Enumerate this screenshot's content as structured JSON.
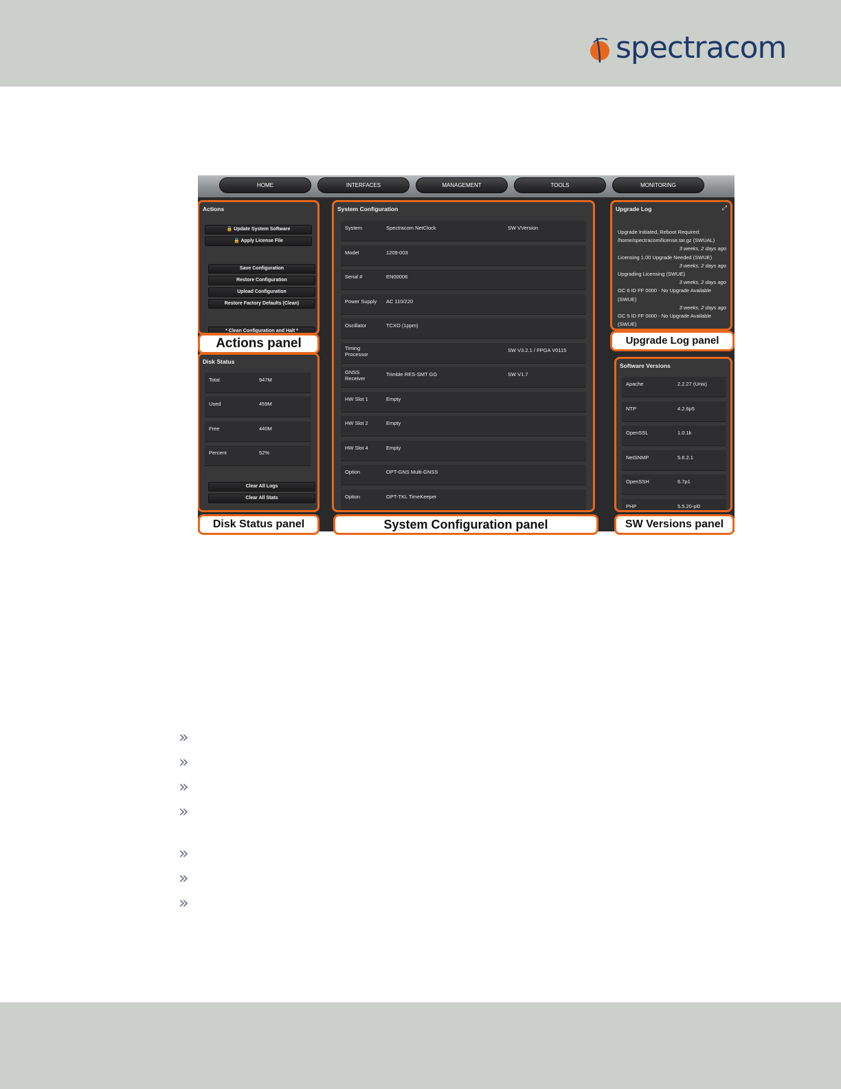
{
  "brand": {
    "logo_text": "spectracom",
    "accent_color": "#e8671c",
    "text_color": "#1e3a6b"
  },
  "nav": {
    "items": [
      "HOME",
      "INTERFACES",
      "MANAGEMENT",
      "TOOLS",
      "MONITORING"
    ]
  },
  "actions": {
    "title": "Actions",
    "buttons": [
      "🔒 Update System Software",
      "🔒 Apply License File",
      "Save Configuration",
      "Restore Configuration",
      "Upload Configuration",
      "Restore Factory Defaults (Clean)",
      "* Clean Configuration and Halt *"
    ],
    "caption": "Actions panel"
  },
  "disk": {
    "title": "Disk Status",
    "rows": [
      {
        "label": "Total",
        "value": "947M"
      },
      {
        "label": "Used",
        "value": "459M"
      },
      {
        "label": "Free",
        "value": "440M"
      },
      {
        "label": "Percent",
        "value": "52%"
      }
    ],
    "buttons": [
      "Clear All Logs",
      "Clear All Stats"
    ],
    "caption": "Disk Status panel"
  },
  "sysconfig": {
    "title": "System Configuration",
    "rows": [
      {
        "label": "System",
        "value": "Spectracom NetClock",
        "extra": "SW VVersion"
      },
      {
        "label": "Model",
        "value": "1209-003",
        "extra": ""
      },
      {
        "label": "Serial #",
        "value": "EN00006",
        "extra": ""
      },
      {
        "label": "Power Supply",
        "value": "AC 110/220",
        "extra": ""
      },
      {
        "label": "Oscillator",
        "value": "TCXO (1ppm)",
        "extra": ""
      },
      {
        "label": "Timing Processor",
        "value": "",
        "extra": "SW V3.2.1 / FPGA V0115"
      },
      {
        "label": "GNSS Receiver",
        "value": "Trimble RES-SMT GG",
        "extra": "SW V1.7"
      },
      {
        "label": "HW Slot 1",
        "value": "Empty",
        "extra": ""
      },
      {
        "label": "HW Slot 2",
        "value": "Empty",
        "extra": ""
      },
      {
        "label": "HW Slot 4",
        "value": "Empty",
        "extra": ""
      },
      {
        "label": "Option",
        "value": "OPT-GNS Multi-GNSS",
        "extra": ""
      },
      {
        "label": "Option",
        "value": "OPT-TKL TimeKeeper",
        "extra": ""
      }
    ],
    "caption": "System Configuration panel"
  },
  "upgrade": {
    "title": "Upgrade Log",
    "expand_icon": "expand-icon",
    "lines": [
      {
        "text": "Upgrade Initiated, Reboot Required:",
        "right": false
      },
      {
        "text": "/home/spectracom/license.tar.gz (SWUAL)",
        "right": false
      },
      {
        "text": "3 weeks, 2 days ago",
        "right": true
      },
      {
        "text": "Licensing 1.00 Upgrade Needed (SWUE)",
        "right": false
      },
      {
        "text": "3 weeks, 2 days ago",
        "right": true
      },
      {
        "text": "Upgrading Licensing (SWUE)",
        "right": false
      },
      {
        "text": "3 weeks, 2 days ago",
        "right": true
      },
      {
        "text": "OC 6 ID FF 0000 - No Upgrade Available",
        "right": false
      },
      {
        "text": "(SWUE)",
        "right": false
      },
      {
        "text": "3 weeks, 2 days ago",
        "right": true
      },
      {
        "text": "OC 5 ID FF 0000 - No Upgrade Available",
        "right": false
      },
      {
        "text": "(SWUE)",
        "right": false
      }
    ],
    "caption": "Upgrade Log panel"
  },
  "software": {
    "title": "Software Versions",
    "rows": [
      {
        "label": "Apache",
        "value": "2.2.27 (Unix)"
      },
      {
        "label": "NTP",
        "value": "4.2.6p5"
      },
      {
        "label": "OpenSSL",
        "value": "1.0.1k"
      },
      {
        "label": "NetSNMP",
        "value": "5.6.2.1"
      },
      {
        "label": "OpenSSH",
        "value": "6.7p1"
      },
      {
        "label": "PHP",
        "value": "5.5.20-pl0"
      }
    ],
    "caption": "SW Versions panel"
  },
  "bullets": {
    "glyph": "»",
    "count": 7
  }
}
